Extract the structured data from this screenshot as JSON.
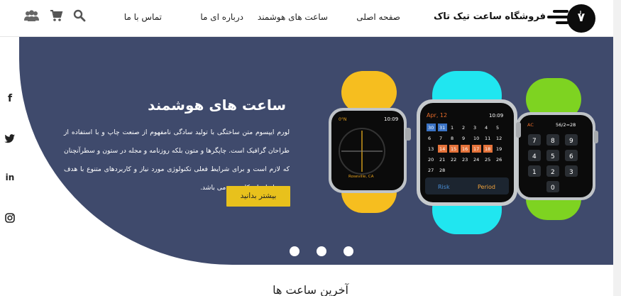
{
  "header": {
    "logo_text": "ٰ٧",
    "brand": "فروشگاه ساعت تیک تاک",
    "nav": [
      "صفحه اصلی",
      "ساعت های هوشمند",
      "درباره ای ما",
      "تماس با ما"
    ],
    "icons": [
      "search-icon",
      "cart-icon",
      "users-icon"
    ]
  },
  "social": [
    "facebook-icon",
    "twitter-icon",
    "linkedin-icon",
    "instagram-icon"
  ],
  "hero": {
    "title": "ساعت های هوشمند",
    "text": "لورم ایپسوم متن ساختگی با تولید سادگی نامفهوم از صنعت چاپ و با استفاده از طراحان گرافیک است. چاپگرها و متون بلکه روزنامه و مجله در ستون و سطرآنچنان که لازم است و برای شرایط فعلی تکنولوژی مورد نیاز و کاربردهای متنوع با هدف بهبود ابزارهای کاربردی می باشد.",
    "button": "بیشتر بدانید",
    "slides": 3,
    "bg_color": "#3f4a6c",
    "accent": "#e8c11c"
  },
  "watch_screens": {
    "left": {
      "label": "0°N",
      "time": "10:09",
      "place": "Roseville, CA"
    },
    "center": {
      "date": "Apr, 12",
      "time": "10:09",
      "days": [
        "30",
        "31",
        "1",
        "2",
        "3",
        "4",
        "5",
        "6",
        "7",
        "8",
        "9",
        "10",
        "11",
        "12",
        "13",
        "14",
        "15",
        "16",
        "17",
        "18",
        "19",
        "20",
        "21",
        "22",
        "23",
        "24",
        "25",
        "26",
        "27",
        "28"
      ],
      "risk": "Risk",
      "period": "Period"
    },
    "right": {
      "ac": "AC",
      "expr": "56/2=28",
      "keys": [
        "7",
        "8",
        "9",
        "4",
        "5",
        "6",
        "1",
        "2",
        "3",
        "0"
      ]
    }
  },
  "section": {
    "title": "آخرین ساعت ها"
  }
}
